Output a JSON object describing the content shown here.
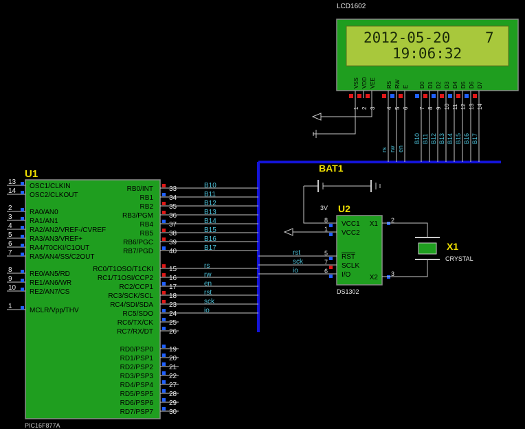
{
  "lcd": {
    "name": "LCD1602",
    "line1": "2012-05-20    7",
    "line2": "19:06:32",
    "pin_names": [
      "VSS",
      "VDD",
      "VEE",
      "RS",
      "RW",
      "E",
      "D0",
      "D1",
      "D2",
      "D3",
      "D4",
      "D5",
      "D6",
      "D7"
    ],
    "pin_numbers": [
      "1",
      "2",
      "3",
      "4",
      "5",
      "6",
      "7",
      "8",
      "9",
      "10",
      "11",
      "12",
      "13",
      "14"
    ],
    "net_labels": [
      "rs",
      "rw",
      "en",
      "B10",
      "B11",
      "B12",
      "B13",
      "B14",
      "B15",
      "B16",
      "B17"
    ]
  },
  "u1": {
    "ref": "U1",
    "part": "PIC16F877A",
    "left_pins": [
      {
        "num": "13",
        "name": "OSC1/CLKIN"
      },
      {
        "num": "14",
        "name": "OSC2/CLKOUT"
      },
      {
        "num": "2",
        "name": "RA0/AN0"
      },
      {
        "num": "3",
        "name": "RA1/AN1"
      },
      {
        "num": "4",
        "name": "RA2/AN2/VREF-/CVREF"
      },
      {
        "num": "5",
        "name": "RA3/AN3/VREF+"
      },
      {
        "num": "6",
        "name": "RA4/T0CKI/C1OUT"
      },
      {
        "num": "7",
        "name": "RA5/AN4/SS/C2OUT"
      },
      {
        "num": "8",
        "name": "RE0/AN5/RD"
      },
      {
        "num": "9",
        "name": "RE1/AN6/WR"
      },
      {
        "num": "10",
        "name": "RE2/AN7/CS"
      },
      {
        "num": "1",
        "name": "MCLR/Vpp/THV"
      }
    ],
    "right_pins": [
      {
        "num": "33",
        "name": "RB0/INT",
        "net": "B10"
      },
      {
        "num": "34",
        "name": "RB1",
        "net": "B11"
      },
      {
        "num": "35",
        "name": "RB2",
        "net": "B12"
      },
      {
        "num": "36",
        "name": "RB3/PGM",
        "net": "B13"
      },
      {
        "num": "37",
        "name": "RB4",
        "net": "B14"
      },
      {
        "num": "38",
        "name": "RB5",
        "net": "B15"
      },
      {
        "num": "39",
        "name": "RB6/PGC",
        "net": "B16"
      },
      {
        "num": "40",
        "name": "RB7/PGD",
        "net": "B17"
      },
      {
        "num": "15",
        "name": "RC0/T1OSO/T1CKI",
        "net": "rs"
      },
      {
        "num": "16",
        "name": "RC1/T1OSI/CCP2",
        "net": "rw"
      },
      {
        "num": "17",
        "name": "RC2/CCP1",
        "net": "en"
      },
      {
        "num": "18",
        "name": "RC3/SCK/SCL",
        "net": "rst"
      },
      {
        "num": "23",
        "name": "RC4/SDI/SDA",
        "net": "sck"
      },
      {
        "num": "24",
        "name": "RC5/SDO",
        "net": "io"
      },
      {
        "num": "25",
        "name": "RC6/TX/CK",
        "net": ""
      },
      {
        "num": "26",
        "name": "RC7/RX/DT",
        "net": ""
      },
      {
        "num": "19",
        "name": "RD0/PSP0",
        "net": ""
      },
      {
        "num": "20",
        "name": "RD1/PSP1",
        "net": ""
      },
      {
        "num": "21",
        "name": "RD2/PSP2",
        "net": ""
      },
      {
        "num": "22",
        "name": "RD3/PSP3",
        "net": ""
      },
      {
        "num": "27",
        "name": "RD4/PSP4",
        "net": ""
      },
      {
        "num": "28",
        "name": "RD5/PSP5",
        "net": ""
      },
      {
        "num": "29",
        "name": "RD6/PSP6",
        "net": ""
      },
      {
        "num": "30",
        "name": "RD7/PSP7",
        "net": ""
      }
    ]
  },
  "u2": {
    "ref": "U2",
    "part": "DS1302",
    "left_pins": [
      {
        "num": "8",
        "name": "VCC1",
        "net": ""
      },
      {
        "num": "1",
        "name": "VCC2",
        "net": ""
      },
      {
        "num": "5",
        "name": "RST",
        "net": "rst"
      },
      {
        "num": "7",
        "name": "SCLK",
        "net": "sck"
      },
      {
        "num": "6",
        "name": "I/O",
        "net": "io"
      }
    ],
    "right_pins": [
      {
        "num": "2",
        "name": "X1"
      },
      {
        "num": "3",
        "name": "X2"
      }
    ]
  },
  "bat1": {
    "ref": "BAT1",
    "value": "3V"
  },
  "x1": {
    "ref": "X1",
    "value": "CRYSTAL"
  },
  "colors": {
    "background": "#000000",
    "chip_fill": "#1f9e1f",
    "lcd_screen": "#a8c83c",
    "bus": "#1414d8",
    "wire": "#c8c8c8",
    "pin_high": "#e01818",
    "pin_low": "#2060ff",
    "ref_label": "#f0e000",
    "net_label": "#4cc0d8"
  }
}
